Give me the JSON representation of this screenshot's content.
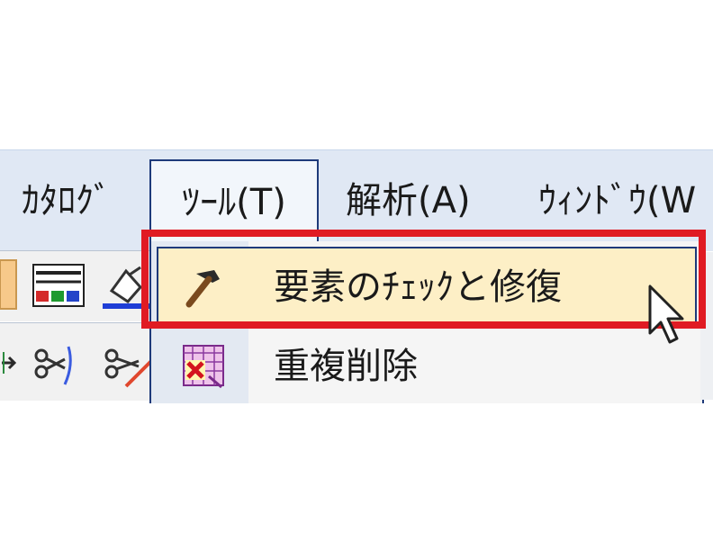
{
  "menubar": {
    "items": [
      {
        "label": "ｶﾀﾛｸﾞ"
      },
      {
        "label": "ﾂｰﾙ(T)"
      },
      {
        "label": "解析(A)"
      },
      {
        "label": "ｳｨﾝﾄﾞｳ(W"
      }
    ]
  },
  "tools_menu": {
    "items": [
      {
        "label": "要素のﾁｪｯｸと修復",
        "icon": "hammer-icon",
        "highlighted": true
      },
      {
        "label": "重複削除",
        "icon": "duplicate-delete-icon",
        "highlighted": false
      }
    ]
  },
  "colors": {
    "menubar_bg": "#e0e8f4",
    "menu_border": "#1e3a7a",
    "hover_bg": "#fdefc6",
    "annotation_red": "#e01b23"
  }
}
